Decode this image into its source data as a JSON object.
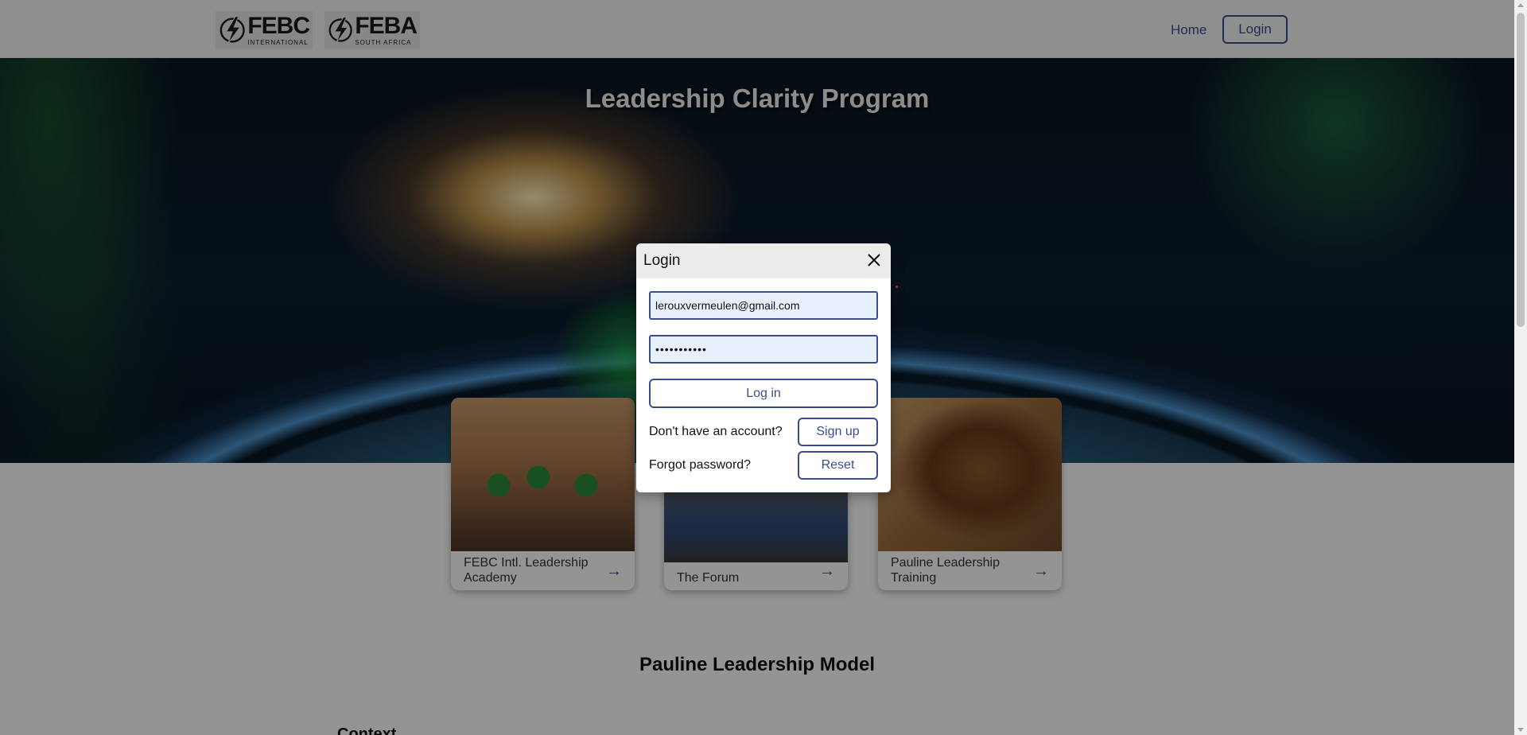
{
  "header": {
    "logos": [
      {
        "name": "FEBC",
        "subtitle": "INTERNATIONAL"
      },
      {
        "name": "FEBA",
        "subtitle": "SOUTH AFRICA"
      }
    ],
    "nav": {
      "home": "Home",
      "login": "Login"
    }
  },
  "hero": {
    "title": "Leadership Clarity Program"
  },
  "cards": [
    {
      "label": "FEBC Intl. Leadership Academy",
      "arrow": "→"
    },
    {
      "label": "The Forum",
      "arrow": "→"
    },
    {
      "label": "Pauline Leadership Training",
      "arrow": "→"
    }
  ],
  "section": {
    "title": "Pauline Leadership Model",
    "subtitle": "Context"
  },
  "modal": {
    "title": "Login",
    "email_value": "lerouxvermeulen@gmail.com",
    "password_value": "•••••••••••",
    "login_button": "Log in",
    "no_account_text": "Don't have an account?",
    "signup_button": "Sign up",
    "forgot_text": "Forgot password?",
    "reset_button": "Reset"
  },
  "colors": {
    "accent": "#3b4d8c",
    "overlay": "rgba(0,0,0,0.42)",
    "field_bg": "#e8f0fe"
  },
  "icons": [
    "bolt-logo-icon",
    "close-icon",
    "arrow-right-icon"
  ]
}
